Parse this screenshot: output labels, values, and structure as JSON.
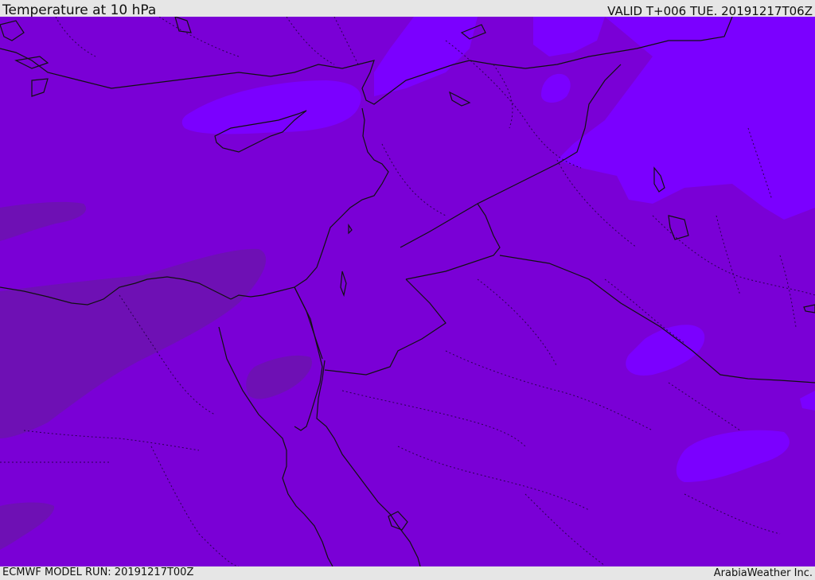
{
  "header": {
    "title": "Temperature at 10 hPa",
    "valid_time": "VALID T+006 TUE. 20191217T06Z"
  },
  "footer": {
    "model_run": "ECMWF MODEL RUN: 20191217T00Z",
    "provider": "ArabiaWeather Inc."
  },
  "colors": {
    "background_field": "#7a00d6",
    "warmer_patch": "#6e10b4",
    "colder_patch": "#7b00ff",
    "coastline": "#111111",
    "border_dotted": "#2a0050"
  }
}
